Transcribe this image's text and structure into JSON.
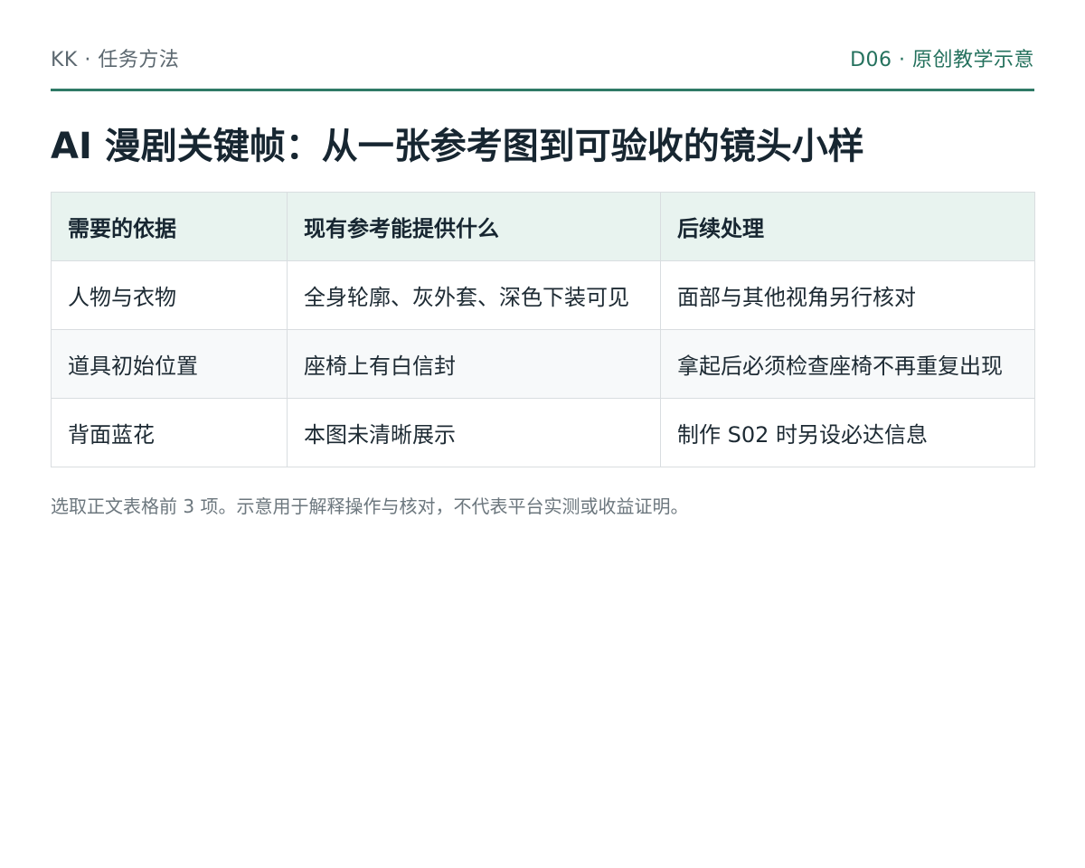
{
  "header": {
    "brand": "KK · 任务方法",
    "tag": "D06 · 原创教学示意"
  },
  "title": "AI 漫剧关键帧：从一张参考图到可验收的镜头小样",
  "table": {
    "columns": [
      "需要的依据",
      "现有参考能提供什么",
      "后续处理"
    ],
    "rows": [
      [
        "人物与衣物",
        "全身轮廓、灰外套、深色下装可见",
        "面部与其他视角另行核对"
      ],
      [
        "道具初始位置",
        "座椅上有白信封",
        "拿起后必须检查座椅不再重复出现"
      ],
      [
        "背面蓝花",
        "本图未清晰展示",
        "制作 S02 时另设必达信息"
      ]
    ]
  },
  "note": "选取正文表格前 3 项。示意用于解释操作与核对，不代表平台实测或收益证明。",
  "colors": {
    "accent": "#2f7a66",
    "header_bg": "#e8f3ef",
    "tag_text": "#24715d"
  }
}
